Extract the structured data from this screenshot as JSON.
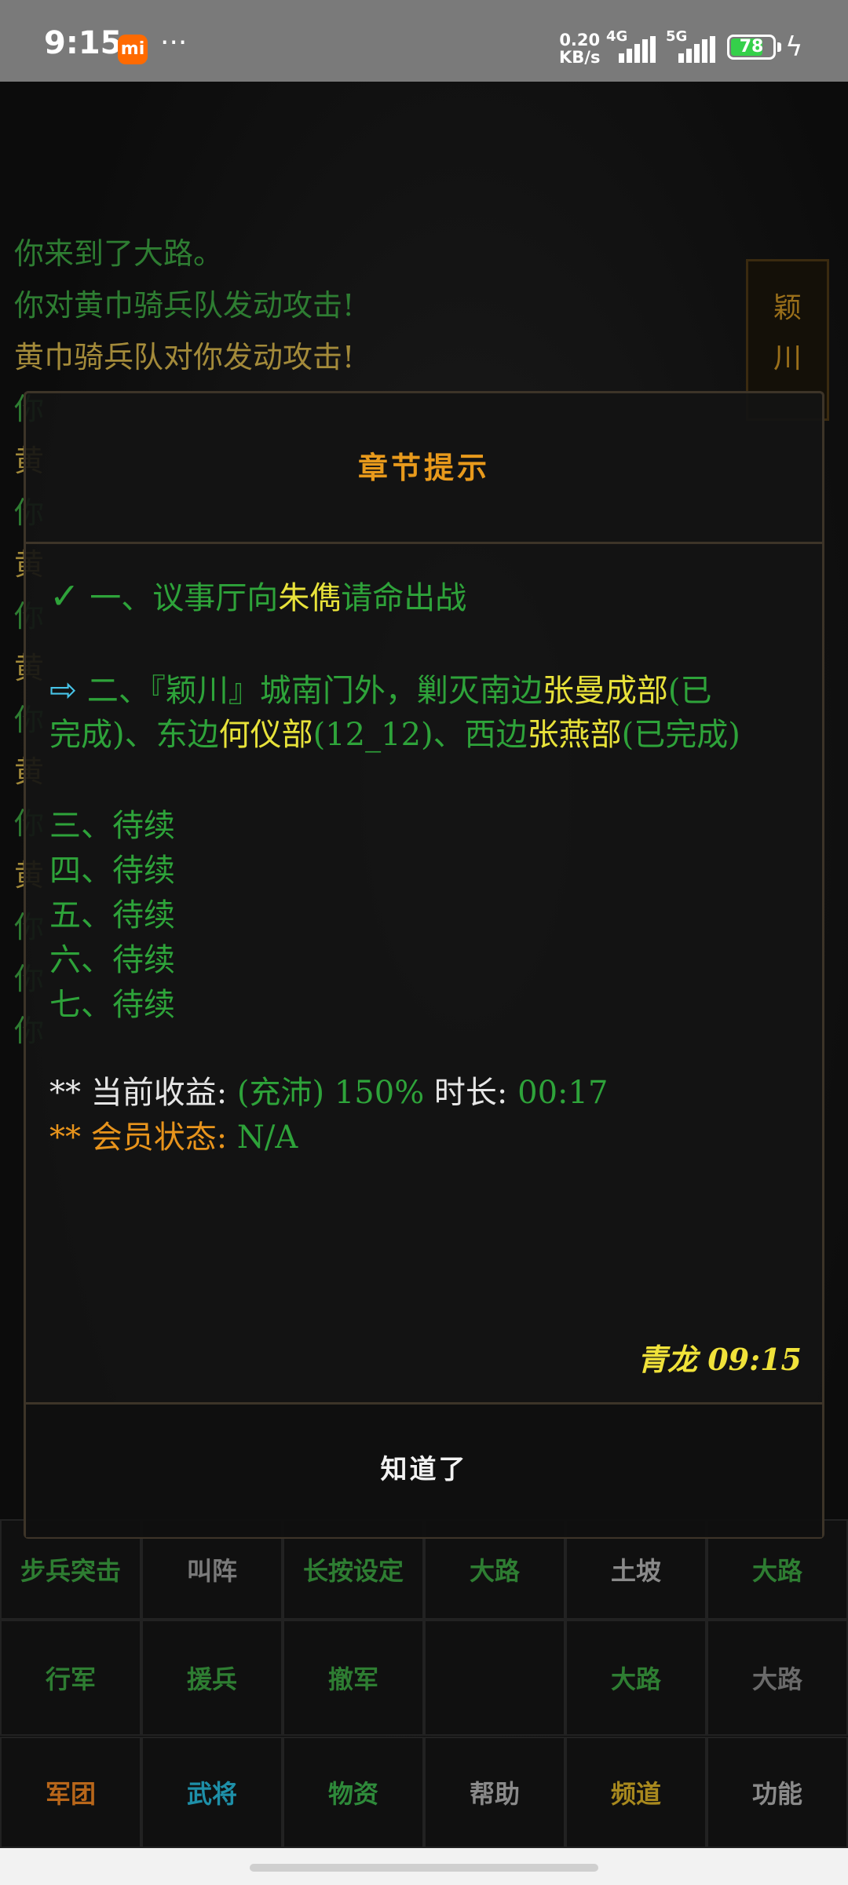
{
  "status_bar": {
    "time": "9:15",
    "mi_badge": "mi",
    "more": "···",
    "speed_value": "0.20",
    "speed_unit": "KB/s",
    "net1": "4G",
    "net2": "5G",
    "battery": "78",
    "battery_level": 0.78
  },
  "background": {
    "log_lines": [
      {
        "text": "你来到了大路。",
        "color": "g"
      },
      {
        "text": "你对黄巾骑兵队发动攻击!",
        "color": "g"
      },
      {
        "text": "黄巾骑兵队对你发动攻击!",
        "color": "y"
      },
      {
        "text": "你",
        "color": "g"
      },
      {
        "text": "黄",
        "color": "y"
      },
      {
        "text": "你",
        "color": "g"
      },
      {
        "text": "黄",
        "color": "y"
      },
      {
        "text": "你",
        "color": "g"
      },
      {
        "text": "黄",
        "color": "y"
      },
      {
        "text": "你",
        "color": "g"
      },
      {
        "text": "黄",
        "color": "y"
      },
      {
        "text": "你",
        "color": "g"
      },
      {
        "text": "黄",
        "color": "y"
      },
      {
        "text": "你",
        "color": "g"
      },
      {
        "text": "你",
        "color": "g"
      },
      {
        "text": "你",
        "color": "g"
      }
    ],
    "side_tab": [
      "颖",
      "川"
    ],
    "action_row1": [
      {
        "label": "步兵突击",
        "color": "#2e7d32"
      },
      {
        "label": "叫阵",
        "color": "#7a7a7a"
      },
      {
        "label": "长按设定",
        "color": "#2e7d32"
      },
      {
        "label": "大路",
        "color": "#2e7d32"
      },
      {
        "label": "土坡",
        "color": "#8a8a8a"
      },
      {
        "label": "大路",
        "color": "#2e7d32"
      }
    ],
    "action_row2": [
      {
        "label": "行军",
        "color": "#2e7d32"
      },
      {
        "label": "援兵",
        "color": "#2e7d32"
      },
      {
        "label": "撤军",
        "color": "#2e7d32"
      },
      {
        "label": "",
        "color": "#2e7d32"
      },
      {
        "label": "大路",
        "color": "#2e7d32"
      },
      {
        "label": "大路",
        "color": "#6a6a6a"
      }
    ],
    "tab_row": [
      {
        "label": "军团",
        "color": "#b8661a"
      },
      {
        "label": "武将",
        "color": "#1e8fa8"
      },
      {
        "label": "物资",
        "color": "#2e8a3a"
      },
      {
        "label": "帮助",
        "color": "#8a8a8a"
      },
      {
        "label": "频道",
        "color": "#a8891e"
      },
      {
        "label": "功能",
        "color": "#8a8a8a"
      }
    ]
  },
  "dialog": {
    "title": "章节提示",
    "item1": {
      "check": "✓",
      "prefix": "一、议事厅向",
      "name": "朱儁",
      "suffix": "请命出战"
    },
    "item2": {
      "arrow": "⇨",
      "p1": "二、『颖川』城南门外，剿灭南边",
      "n1": "张曼成部",
      "s1": "(已",
      "p2": "完成)、东边",
      "n2": "何仪部",
      "s2": "(12_12)、西边",
      "n3": "张燕部",
      "s3": "(已完成)"
    },
    "pending": [
      "三、待续",
      "四、待续",
      "五、待续",
      "六、待续",
      "七、待续"
    ],
    "income": {
      "label": "** 当前收益:",
      "value": "(充沛) 150%",
      "duration_label": "时长:",
      "duration": "00:17"
    },
    "member": {
      "label": "** 会员状态:",
      "value": "N/A"
    },
    "signature_name": "青龙",
    "signature_time": "09:15",
    "ok_button": "知道了"
  }
}
